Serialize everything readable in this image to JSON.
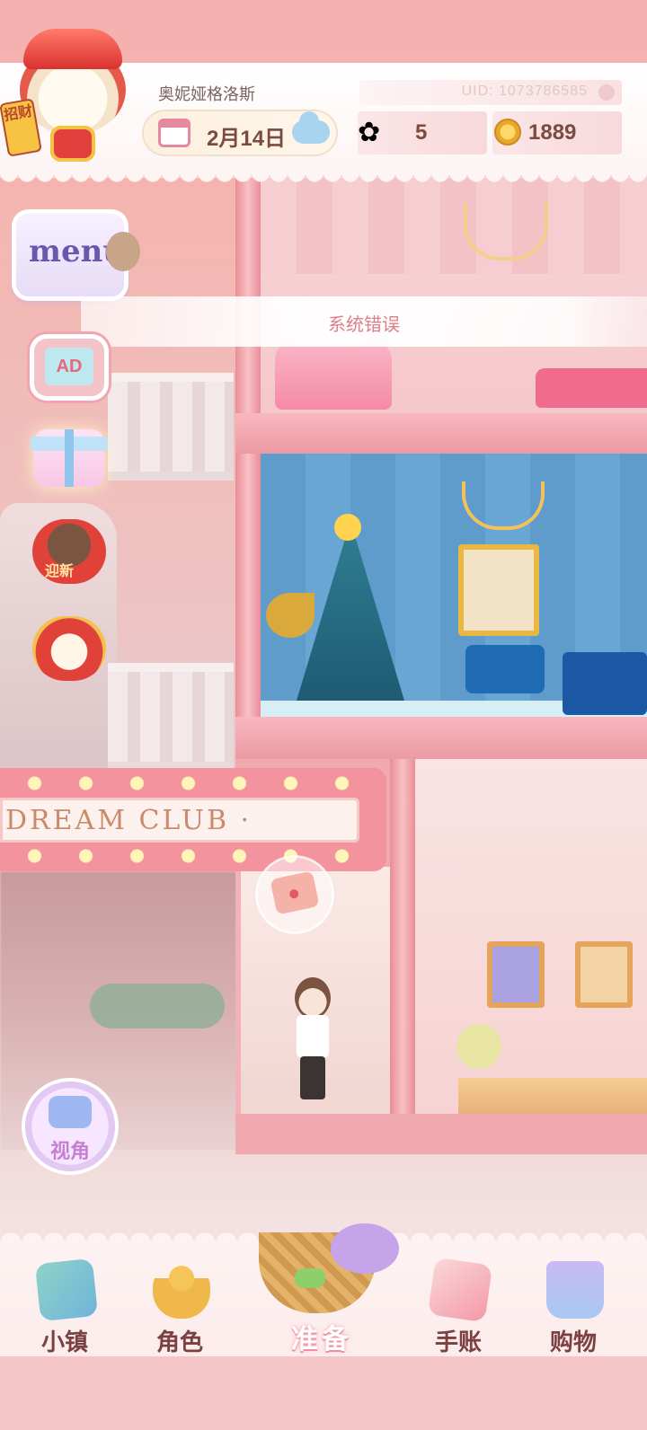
{
  "header": {
    "player_name": "奥妮娅格洛斯",
    "uid": "UID: 1073786585",
    "date": "2月14日",
    "gems": "5",
    "coins": "1889",
    "avatar_tag": "招财"
  },
  "side_buttons": {
    "menu_label": "menu",
    "ad_label": "AD",
    "new_year_label": "迎新",
    "view_label": "视角"
  },
  "notice": {
    "error_text": "系统错误"
  },
  "scene": {
    "sign_text": "DREAM CLUB ·"
  },
  "bottom_nav": {
    "items": [
      {
        "label": "小镇",
        "icon": "map-icon"
      },
      {
        "label": "角色",
        "icon": "character-icon"
      },
      {
        "label": "准备",
        "icon": "basket-icon"
      },
      {
        "label": "手账",
        "icon": "diary-icon"
      },
      {
        "label": "购物",
        "icon": "shopping-bag-icon"
      }
    ]
  },
  "colors": {
    "accent_pink": "#f2939d",
    "text_brown": "#7b4b3f",
    "error_pink": "#dd7f8c"
  }
}
